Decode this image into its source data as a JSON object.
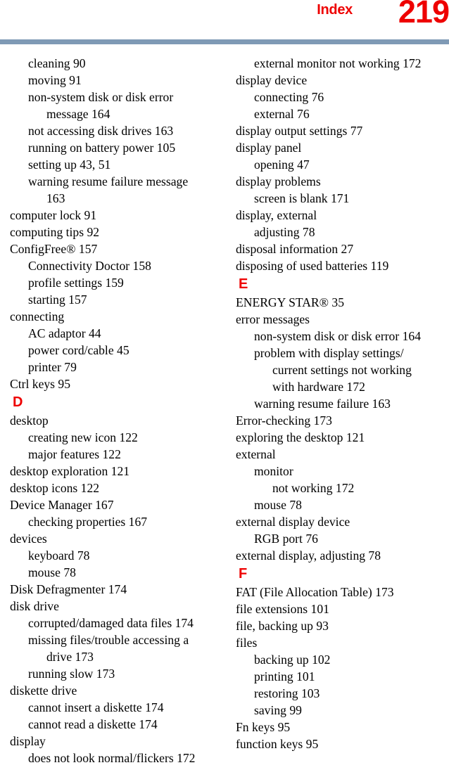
{
  "header": {
    "section_label": "Index",
    "page_number": "219",
    "accent_color": "#ee0000",
    "rule_color": "#7f9ab5"
  },
  "columns": [
    {
      "id": "left",
      "blocks": [
        {
          "kind": "entry",
          "level": 1,
          "text": "cleaning 90"
        },
        {
          "kind": "entry",
          "level": 1,
          "text": "moving 91"
        },
        {
          "kind": "entry",
          "level": 1,
          "text": "non-system disk or disk error"
        },
        {
          "kind": "entry",
          "level": 2,
          "text": "message 164"
        },
        {
          "kind": "entry",
          "level": 1,
          "text": "not accessing disk drives 163"
        },
        {
          "kind": "entry",
          "level": 1,
          "text": "running on battery power 105"
        },
        {
          "kind": "entry",
          "level": 1,
          "text": "setting up 43, 51"
        },
        {
          "kind": "entry",
          "level": 1,
          "text": "warning resume failure message"
        },
        {
          "kind": "entry",
          "level": 2,
          "text": "163"
        },
        {
          "kind": "entry",
          "level": 0,
          "text": "computer lock 91"
        },
        {
          "kind": "entry",
          "level": 0,
          "text": "computing tips 92"
        },
        {
          "kind": "entry",
          "level": 0,
          "text": "ConfigFree® 157"
        },
        {
          "kind": "entry",
          "level": 1,
          "text": "Connectivity Doctor 158"
        },
        {
          "kind": "entry",
          "level": 1,
          "text": "profile settings 159"
        },
        {
          "kind": "entry",
          "level": 1,
          "text": "starting 157"
        },
        {
          "kind": "entry",
          "level": 0,
          "text": "connecting"
        },
        {
          "kind": "entry",
          "level": 1,
          "text": "AC adaptor 44"
        },
        {
          "kind": "entry",
          "level": 1,
          "text": "power cord/cable 45"
        },
        {
          "kind": "entry",
          "level": 1,
          "text": "printer 79"
        },
        {
          "kind": "entry",
          "level": 0,
          "text": "Ctrl keys 95"
        },
        {
          "kind": "letter",
          "text": "D"
        },
        {
          "kind": "entry",
          "level": 0,
          "text": "desktop"
        },
        {
          "kind": "entry",
          "level": 1,
          "text": "creating new icon 122"
        },
        {
          "kind": "entry",
          "level": 1,
          "text": "major features 122"
        },
        {
          "kind": "entry",
          "level": 0,
          "text": "desktop exploration 121"
        },
        {
          "kind": "entry",
          "level": 0,
          "text": "desktop icons 122"
        },
        {
          "kind": "entry",
          "level": 0,
          "text": "Device Manager 167"
        },
        {
          "kind": "entry",
          "level": 1,
          "text": "checking properties 167"
        },
        {
          "kind": "entry",
          "level": 0,
          "text": "devices"
        },
        {
          "kind": "entry",
          "level": 1,
          "text": "keyboard 78"
        },
        {
          "kind": "entry",
          "level": 1,
          "text": "mouse 78"
        },
        {
          "kind": "entry",
          "level": 0,
          "text": "Disk Defragmenter 174"
        },
        {
          "kind": "entry",
          "level": 0,
          "text": "disk drive"
        },
        {
          "kind": "entry",
          "level": 1,
          "text": "corrupted/damaged data files 174"
        },
        {
          "kind": "entry",
          "level": 1,
          "text": "missing files/trouble accessing a"
        },
        {
          "kind": "entry",
          "level": 2,
          "text": "drive 173"
        },
        {
          "kind": "entry",
          "level": 1,
          "text": "running slow 173"
        },
        {
          "kind": "entry",
          "level": 0,
          "text": "diskette drive"
        },
        {
          "kind": "entry",
          "level": 1,
          "text": "cannot insert a diskette 174"
        },
        {
          "kind": "entry",
          "level": 1,
          "text": "cannot read a diskette 174"
        },
        {
          "kind": "entry",
          "level": 0,
          "text": "display"
        },
        {
          "kind": "entry",
          "level": 1,
          "text": "does not look normal/flickers 172"
        }
      ]
    },
    {
      "id": "right",
      "blocks": [
        {
          "kind": "entry",
          "level": 1,
          "text": "external monitor not working 172"
        },
        {
          "kind": "entry",
          "level": 0,
          "text": "display device"
        },
        {
          "kind": "entry",
          "level": 1,
          "text": "connecting 76"
        },
        {
          "kind": "entry",
          "level": 1,
          "text": "external 76"
        },
        {
          "kind": "entry",
          "level": 0,
          "text": "display output settings 77"
        },
        {
          "kind": "entry",
          "level": 0,
          "text": "display panel"
        },
        {
          "kind": "entry",
          "level": 1,
          "text": "opening 47"
        },
        {
          "kind": "entry",
          "level": 0,
          "text": "display problems"
        },
        {
          "kind": "entry",
          "level": 1,
          "text": "screen is blank 171"
        },
        {
          "kind": "entry",
          "level": 0,
          "text": "display, external"
        },
        {
          "kind": "entry",
          "level": 1,
          "text": "adjusting 78"
        },
        {
          "kind": "entry",
          "level": 0,
          "text": "disposal information 27"
        },
        {
          "kind": "entry",
          "level": 0,
          "text": "disposing of used batteries 119"
        },
        {
          "kind": "letter",
          "text": "E"
        },
        {
          "kind": "entry",
          "level": 0,
          "text": "ENERGY STAR® 35"
        },
        {
          "kind": "entry",
          "level": 0,
          "text": "error messages"
        },
        {
          "kind": "entry",
          "level": 1,
          "text": "non-system disk or disk error 164"
        },
        {
          "kind": "entry",
          "level": 1,
          "text": "problem with display settings/"
        },
        {
          "kind": "entry",
          "level": 2,
          "text": "current settings not working"
        },
        {
          "kind": "entry",
          "level": 2,
          "text": "with hardware 172"
        },
        {
          "kind": "entry",
          "level": 1,
          "text": "warning resume failure 163"
        },
        {
          "kind": "entry",
          "level": 0,
          "text": "Error-checking 173"
        },
        {
          "kind": "entry",
          "level": 0,
          "text": "exploring the desktop 121"
        },
        {
          "kind": "entry",
          "level": 0,
          "text": "external"
        },
        {
          "kind": "entry",
          "level": 1,
          "text": "monitor"
        },
        {
          "kind": "entry",
          "level": 2,
          "text": "not working 172"
        },
        {
          "kind": "entry",
          "level": 1,
          "text": "mouse 78"
        },
        {
          "kind": "entry",
          "level": 0,
          "text": "external display device"
        },
        {
          "kind": "entry",
          "level": 1,
          "text": "RGB port 76"
        },
        {
          "kind": "entry",
          "level": 0,
          "text": "external display, adjusting 78"
        },
        {
          "kind": "letter",
          "text": "F"
        },
        {
          "kind": "entry",
          "level": 0,
          "text": "FAT (File Allocation Table) 173"
        },
        {
          "kind": "entry",
          "level": 0,
          "text": "file extensions 101"
        },
        {
          "kind": "entry",
          "level": 0,
          "text": "file, backing up 93"
        },
        {
          "kind": "entry",
          "level": 0,
          "text": "files"
        },
        {
          "kind": "entry",
          "level": 1,
          "text": "backing up 102"
        },
        {
          "kind": "entry",
          "level": 1,
          "text": "printing 101"
        },
        {
          "kind": "entry",
          "level": 1,
          "text": "restoring 103"
        },
        {
          "kind": "entry",
          "level": 1,
          "text": "saving 99"
        },
        {
          "kind": "entry",
          "level": 0,
          "text": "Fn keys 95"
        },
        {
          "kind": "entry",
          "level": 0,
          "text": "function keys 95"
        }
      ]
    }
  ]
}
